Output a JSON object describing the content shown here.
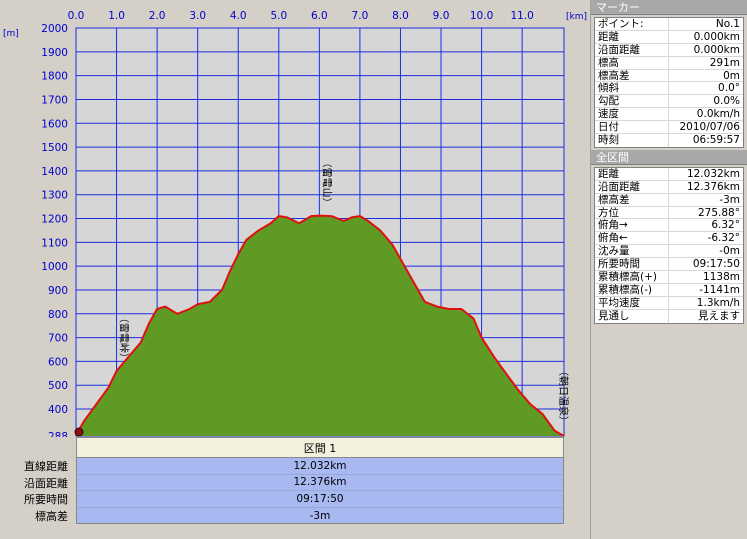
{
  "chart_data": {
    "type": "area",
    "x_unit": "[km]",
    "y_unit": "[m]",
    "x_ticks": [
      "0.0",
      "1.0",
      "2.0",
      "3.0",
      "4.0",
      "5.0",
      "6.0",
      "7.0",
      "8.0",
      "9.0",
      "10.0",
      "11.0"
    ],
    "y_ticks": [
      "2000",
      "1900",
      "1800",
      "1700",
      "1600",
      "1500",
      "1400",
      "1300",
      "1200",
      "1100",
      "1000",
      "900",
      "800",
      "700",
      "600",
      "500",
      "400",
      "288"
    ],
    "xlim": [
      0,
      12.032
    ],
    "ylim": [
      288,
      2000
    ],
    "series": [
      {
        "x": [
          0,
          0.2,
          0.5,
          0.8,
          1.0,
          1.3,
          1.6,
          1.8,
          2.0,
          2.2,
          2.5,
          2.8,
          3.0,
          3.3,
          3.6,
          3.8,
          4.0,
          4.2,
          4.5,
          4.8,
          5.0,
          5.2,
          5.5,
          5.8,
          6.0,
          6.3,
          6.6,
          6.8,
          7.0,
          7.2,
          7.5,
          7.8,
          8.0,
          8.3,
          8.6,
          8.9,
          9.2,
          9.5,
          9.8,
          10.0,
          10.3,
          10.6,
          10.9,
          11.2,
          11.5,
          11.8,
          12.032
        ],
        "y": [
          291,
          350,
          420,
          490,
          560,
          620,
          680,
          760,
          820,
          830,
          800,
          820,
          840,
          850,
          900,
          980,
          1050,
          1110,
          1150,
          1180,
          1210,
          1205,
          1180,
          1210,
          1212,
          1210,
          1190,
          1205,
          1210,
          1190,
          1150,
          1090,
          1030,
          940,
          850,
          830,
          820,
          820,
          780,
          700,
          620,
          550,
          480,
          420,
          380,
          310,
          288
        ]
      }
    ],
    "annotations": [
      {
        "x": 1.0,
        "y": 560,
        "label": "（雷電峠）"
      },
      {
        "x": 6.0,
        "y": 1212,
        "label": "（雷電山）"
      },
      {
        "x": 12.032,
        "y": 288,
        "label": "（朝日温泉）"
      }
    ],
    "colors": {
      "fill": "#5e9a24",
      "line": "#e01010",
      "grid": "#1c2ee0",
      "bg": "#d6d6d6"
    }
  },
  "section": {
    "header": "区間 1",
    "rows": [
      {
        "label": "直線距離",
        "value": "12.032km"
      },
      {
        "label": "沿面距離",
        "value": "12.376km"
      },
      {
        "label": "所要時間",
        "value": "09:17:50"
      },
      {
        "label": "標高差",
        "value": "-3m"
      }
    ]
  },
  "marker_panel": {
    "title": "マーカー",
    "rows": [
      {
        "k": "ポイント:",
        "v": "No.1"
      },
      {
        "k": "距離",
        "v": "0.000km"
      },
      {
        "k": "沿面距離",
        "v": "0.000km"
      },
      {
        "k": "標高",
        "v": "291m"
      },
      {
        "k": "標高差",
        "v": "0m"
      },
      {
        "k": "傾斜",
        "v": "0.0°"
      },
      {
        "k": "勾配",
        "v": "0.0%"
      },
      {
        "k": "速度",
        "v": "0.0km/h"
      },
      {
        "k": "日付",
        "v": "2010/07/06"
      },
      {
        "k": "時刻",
        "v": "06:59:57"
      }
    ]
  },
  "total_panel": {
    "title": "全区間",
    "rows": [
      {
        "k": "距離",
        "v": "12.032km"
      },
      {
        "k": "沿面距離",
        "v": "12.376km"
      },
      {
        "k": "標高差",
        "v": "-3m"
      },
      {
        "k": "方位",
        "v": "275.88°"
      },
      {
        "k": "俯角→",
        "v": "6.32°"
      },
      {
        "k": "俯角←",
        "v": "-6.32°"
      },
      {
        "k": "沈み量",
        "v": "-0m"
      },
      {
        "k": "所要時間",
        "v": "09:17:50"
      },
      {
        "k": "累積標高(+)",
        "v": "1138m"
      },
      {
        "k": "累積標高(-)",
        "v": "-1141m"
      },
      {
        "k": "平均速度",
        "v": "1.3km/h"
      },
      {
        "k": "見通し",
        "v": "見えます"
      }
    ]
  }
}
